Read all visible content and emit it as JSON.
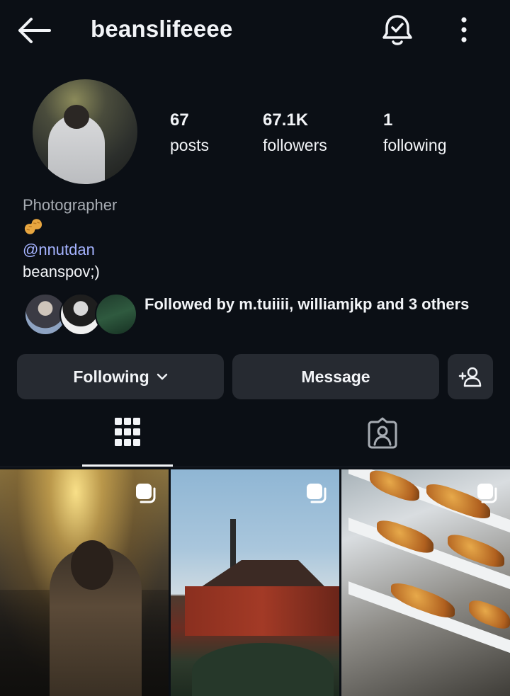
{
  "header": {
    "username": "beanslifeeee",
    "back_icon": "arrow-left-icon",
    "notify_icon": "bell-check-icon",
    "more_icon": "more-vertical-icon"
  },
  "profile": {
    "stats": [
      {
        "value": "67",
        "label": "posts"
      },
      {
        "value": "67.1K",
        "label": "followers"
      },
      {
        "value": "1",
        "label": "following"
      }
    ],
    "bio": {
      "role": "Photographer",
      "emoji": "peanut",
      "handle": "@nnutdan",
      "text": "beanspov;)"
    },
    "followed_by": "Followed by m.tuiiii, williamjkp and 3 others"
  },
  "actions": {
    "following_label": "Following",
    "message_label": "Message",
    "add_user_icon": "add-user-icon"
  },
  "tabs": [
    {
      "name": "posts-grid",
      "icon": "grid-icon",
      "active": true
    },
    {
      "name": "tagged",
      "icon": "tagged-person-icon",
      "active": false
    }
  ],
  "colors": {
    "background": "#0b0f15",
    "button": "#262a31",
    "link": "#a5b3ff",
    "muted": "#a7acb3"
  },
  "posts": [
    {
      "name": "post-1",
      "multi": true
    },
    {
      "name": "post-2",
      "multi": true
    },
    {
      "name": "post-3",
      "multi": true
    }
  ]
}
